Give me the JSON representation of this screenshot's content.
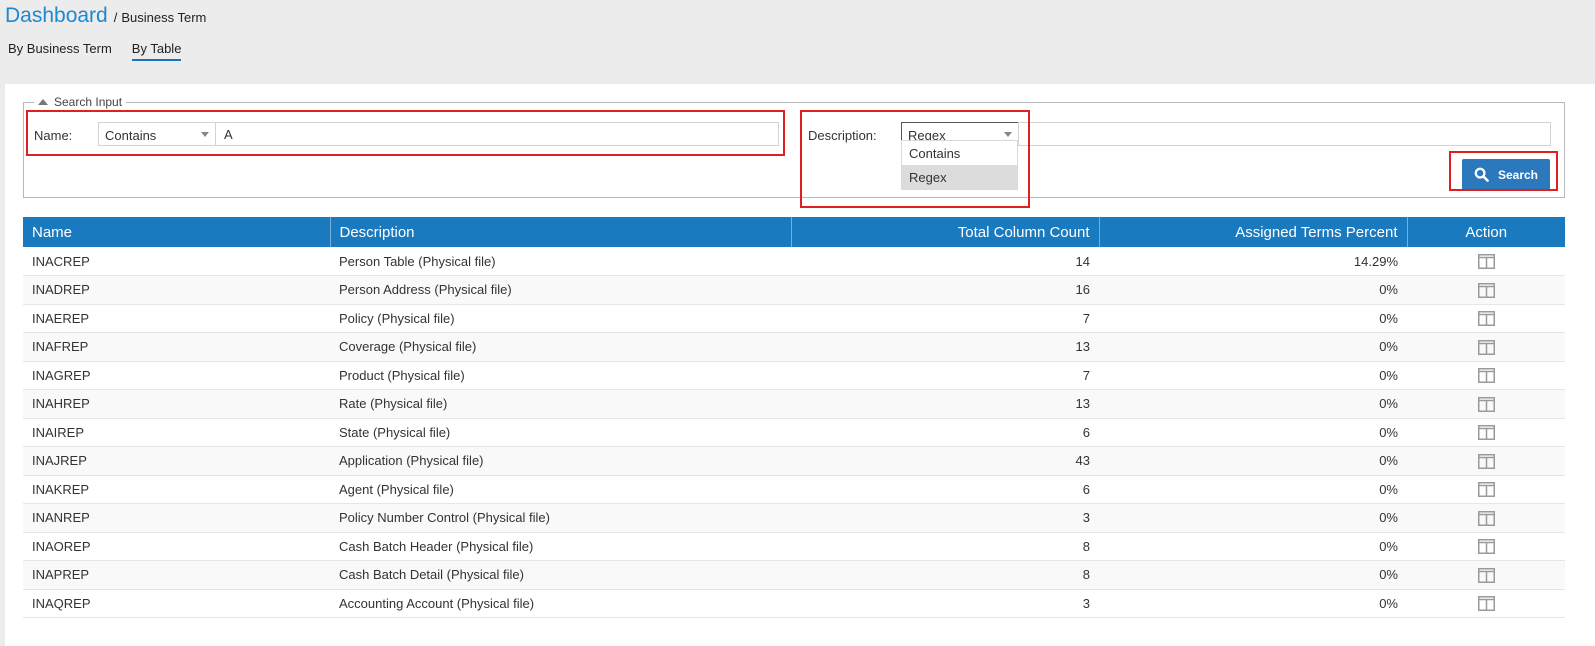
{
  "breadcrumb": {
    "home": "Dashboard",
    "separator": "/",
    "current": "Business Term"
  },
  "tabs": [
    {
      "label": "By Business Term",
      "active": false
    },
    {
      "label": "By Table",
      "active": true
    }
  ],
  "search": {
    "legend": "Search Input",
    "name_label": "Name:",
    "name_mode": "Contains",
    "name_value": "A",
    "description_label": "Description:",
    "description_mode": "Regex",
    "description_value": "",
    "mode_options": [
      "Contains",
      "Regex"
    ],
    "button_label": "Search"
  },
  "table": {
    "columns": [
      "Name",
      "Description",
      "Total Column Count",
      "Assigned Terms Percent",
      "Action"
    ],
    "rows": [
      {
        "name": "INACREP",
        "description": "Person Table (Physical file)",
        "count": "14",
        "percent": "14.29%"
      },
      {
        "name": "INADREP",
        "description": "Person Address (Physical file)",
        "count": "16",
        "percent": "0%"
      },
      {
        "name": "INAEREP",
        "description": "Policy (Physical file)",
        "count": "7",
        "percent": "0%"
      },
      {
        "name": "INAFREP",
        "description": "Coverage (Physical file)",
        "count": "13",
        "percent": "0%"
      },
      {
        "name": "INAGREP",
        "description": "Product (Physical file)",
        "count": "7",
        "percent": "0%"
      },
      {
        "name": "INAHREP",
        "description": "Rate (Physical file)",
        "count": "13",
        "percent": "0%"
      },
      {
        "name": "INAIREP",
        "description": "State (Physical file)",
        "count": "6",
        "percent": "0%"
      },
      {
        "name": "INAJREP",
        "description": "Application (Physical file)",
        "count": "43",
        "percent": "0%"
      },
      {
        "name": "INAKREP",
        "description": "Agent (Physical file)",
        "count": "6",
        "percent": "0%"
      },
      {
        "name": "INANREP",
        "description": "Policy Number Control (Physical file)",
        "count": "3",
        "percent": "0%"
      },
      {
        "name": "INAOREP",
        "description": "Cash Batch Header (Physical file)",
        "count": "8",
        "percent": "0%"
      },
      {
        "name": "INAPREP",
        "description": "Cash Batch Detail (Physical file)",
        "count": "8",
        "percent": "0%"
      },
      {
        "name": "INAQREP",
        "description": "Accounting Account (Physical file)",
        "count": "3",
        "percent": "0%"
      }
    ]
  },
  "colors": {
    "accent": "#1a7abf",
    "link": "#1e88d0",
    "highlight": "#e02020",
    "button": "#2b79bc"
  },
  "icons": {
    "search": "magnifier-icon",
    "action": "columns-icon",
    "legend_toggle": "triangle-up-icon"
  }
}
